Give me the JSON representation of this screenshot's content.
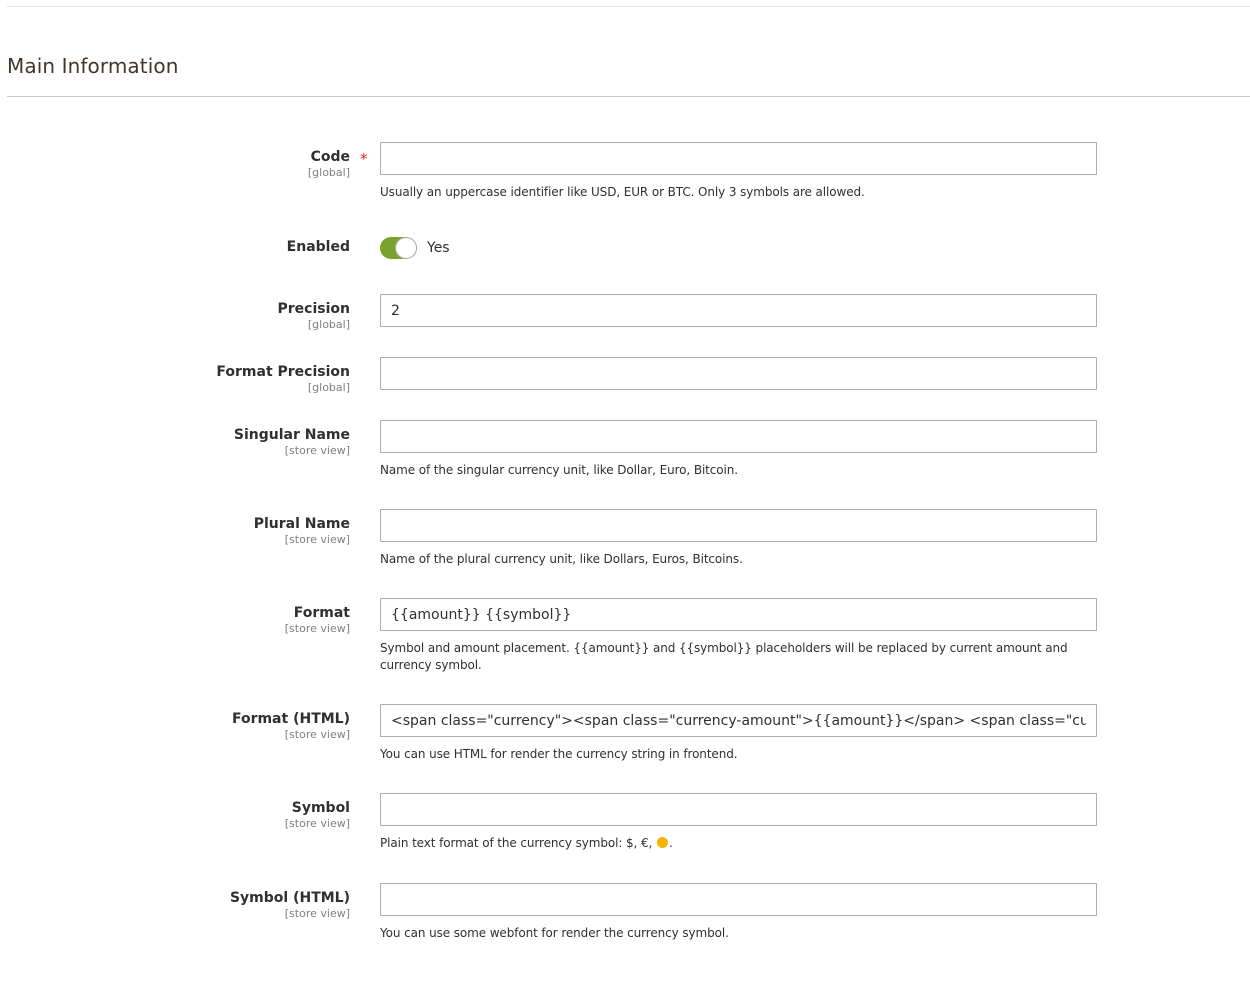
{
  "section": {
    "title": "Main Information"
  },
  "fields": {
    "code": {
      "label": "Code",
      "scope": "[global]",
      "required_mark": "*",
      "value": "",
      "note": "Usually an uppercase identifier like USD, EUR or BTC. Only 3 symbols are allowed."
    },
    "enabled": {
      "label": "Enabled",
      "state": "Yes",
      "checked": true,
      "accent_color": "#79a22e"
    },
    "precision": {
      "label": "Precision",
      "scope": "[global]",
      "value": "2"
    },
    "format_precision": {
      "label": "Format Precision",
      "scope": "[global]",
      "value": ""
    },
    "singular_name": {
      "label": "Singular Name",
      "scope": "[store view]",
      "value": "",
      "note": "Name of the singular currency unit, like Dollar, Euro, Bitcoin."
    },
    "plural_name": {
      "label": "Plural Name",
      "scope": "[store view]",
      "value": "",
      "note": "Name of the plural currency unit, like Dollars, Euros, Bitcoins."
    },
    "format": {
      "label": "Format",
      "scope": "[store view]",
      "value": "{{amount}} {{symbol}}",
      "note": "Symbol and amount placement. {{amount}} and {{symbol}} placeholders will be replaced by current amount and currency symbol."
    },
    "format_html": {
      "label": "Format (HTML)",
      "scope": "[store view]",
      "value": "<span class=\"currency\"><span class=\"currency-amount\">{{amount}}</span> <span class=\"currency-symbol\">{{symbol}}</span></span>",
      "note": "You can use HTML for render the currency string in frontend."
    },
    "symbol": {
      "label": "Symbol",
      "scope": "[store view]",
      "value": "",
      "note_prefix": "Plain text format of the currency symbol: $, €, ",
      "note_icon": "coin-emoji-icon",
      "note_suffix": "."
    },
    "symbol_html": {
      "label": "Symbol (HTML)",
      "scope": "[store view]",
      "value": "",
      "note": "You can use some webfont for render the currency symbol."
    }
  }
}
